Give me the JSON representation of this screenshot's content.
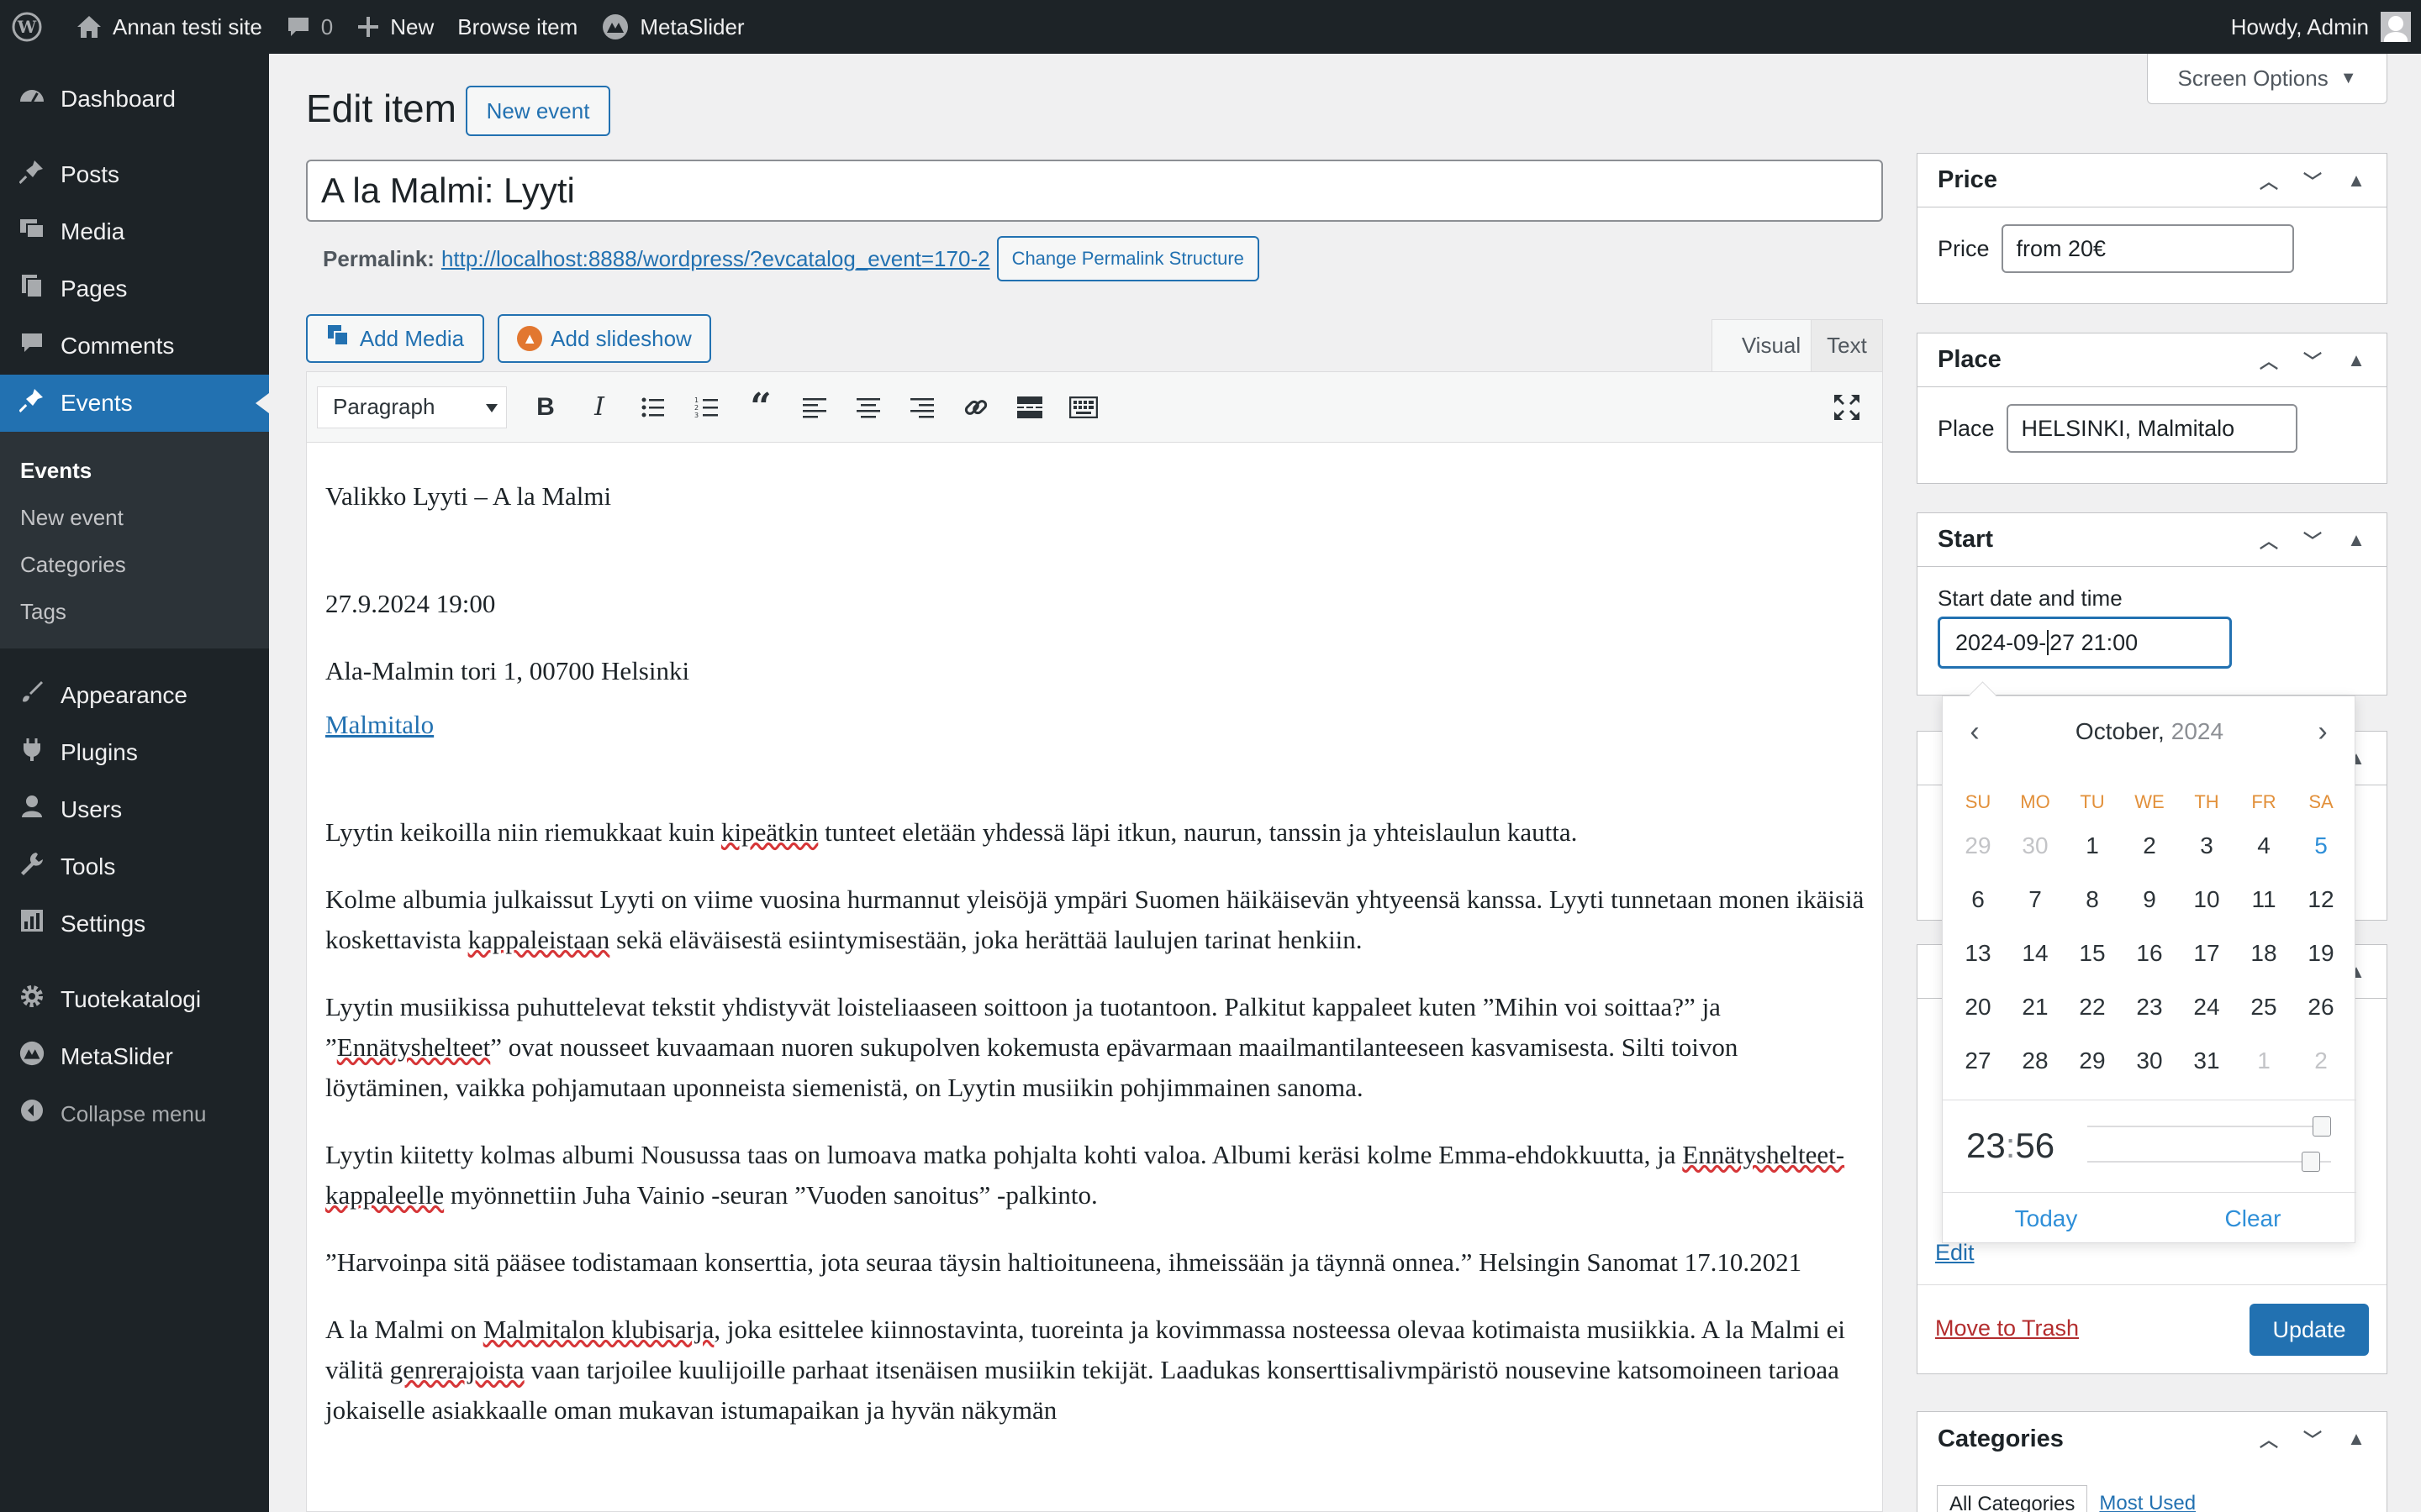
{
  "adminbar": {
    "site_name": "Annan testi site",
    "comments_count": "0",
    "new_label": "New",
    "browse_label": "Browse item",
    "metaslider_label": "MetaSlider",
    "howdy": "Howdy, Admin"
  },
  "sidebar": {
    "items": [
      {
        "label": "Dashboard",
        "icon": "dashboard-icon"
      },
      {
        "label": "Posts",
        "icon": "pin-icon"
      },
      {
        "label": "Media",
        "icon": "media-icon"
      },
      {
        "label": "Pages",
        "icon": "pages-icon"
      },
      {
        "label": "Comments",
        "icon": "comments-icon"
      },
      {
        "label": "Events",
        "icon": "pin-icon"
      },
      {
        "label": "Appearance",
        "icon": "brush-icon"
      },
      {
        "label": "Plugins",
        "icon": "plugin-icon"
      },
      {
        "label": "Users",
        "icon": "users-icon"
      },
      {
        "label": "Tools",
        "icon": "wrench-icon"
      },
      {
        "label": "Settings",
        "icon": "settings-icon"
      },
      {
        "label": "Tuotekatalogi",
        "icon": "gear-icon"
      },
      {
        "label": "MetaSlider",
        "icon": "metaslider-icon"
      }
    ],
    "submenu": [
      "Events",
      "New event",
      "Categories",
      "Tags"
    ],
    "collapse_label": "Collapse menu"
  },
  "header": {
    "screen_options": "Screen Options",
    "page_title": "Edit item",
    "new_event_button": "New event"
  },
  "post": {
    "title": "A la Malmi: Lyyti",
    "permalink_label": "Permalink:",
    "permalink_url": "http://localhost:8888/wordpress/?evcatalog_event=170-2",
    "change_permalink_button": "Change Permalink Structure"
  },
  "editor": {
    "add_media": "Add Media",
    "add_slideshow": "Add slideshow",
    "tab_visual": "Visual",
    "tab_text": "Text",
    "format": "Paragraph",
    "content": {
      "p1": "Valikko Lyyti – A la Malmi",
      "p2": "27.9.2024 19:00",
      "p3": "Ala-Malmin tori 1, 00700 Helsinki",
      "p4_link": "Malmitalo",
      "p5a": "Lyytin keikoilla niin riemukkaat kuin ",
      "p5b": "kipeätkin",
      "p5c": " tunteet eletään yhdessä läpi itkun, naurun, tanssin ja yhteislaulun kautta.",
      "p6a": "Kolme albumia julkaissut Lyyti on viime vuosina hurmannut yleisöjä ympäri Suomen häikäisevän yhtyeensä kanssa. Lyyti tunnetaan monen ikäisiä koskettavista ",
      "p6b": "kappaleistaan",
      "p6c": " sekä eläväisestä esiintymisestään, joka herättää laulujen tarinat henkiin.",
      "p7a": "Lyytin musiikissa puhuttelevat tekstit yhdistyvät loisteliaaseen soittoon ja tuotantoon. Palkitut kappaleet kuten ”Mihin voi soittaa?” ja ”",
      "p7b": "Ennätyshelteet",
      "p7c": "” ovat nousseet kuvaamaan nuoren sukupolven kokemusta epävarmaan maailmantilanteeseen kasvamisesta. Silti toivon löytäminen, vaikka pohjamutaan uponneista siemenistä, on Lyytin musiikin pohjimmainen sanoma.",
      "p8a": "Lyytin kiitetty kolmas albumi Nousussa taas on lumoava matka pohjalta kohti valoa. Albumi keräsi kolme Emma-ehdokkuutta, ja ",
      "p8b": "Ennätyshelteet-kappaleelle",
      "p8c": " myönnettiin Juha Vainio -seuran ”Vuoden sanoitus” -palkinto.",
      "p9": "”Harvoinpa sitä pääsee todistamaan konserttia, jota seuraa täysin haltioituneena, ihmeissään ja täynnä onnea.” Helsingin Sanomat 17.10.2021",
      "p10a": "A la Malmi on ",
      "p10b": "Malmitalon klubisarja",
      "p10c": ", joka esittelee kiinnostavinta, tuoreinta ja kovimmassa nosteessa olevaa kotimaista musiikkia. A la Malmi ei välitä ",
      "p10d": "genrerajoista",
      "p10e": " vaan tarjoilee kuulijoille parhaat itsenäisen musiikin tekijät. Laadukas konserttisalivmpäristö nousevine katsomoineen tarioaa jokaiselle asiakkaalle oman mukavan istumapaikan ja hyvän näkymän"
    }
  },
  "price_box": {
    "title": "Price",
    "label": "Price",
    "value": "from 20€"
  },
  "place_box": {
    "title": "Place",
    "label": "Place",
    "value": "HELSINKI, Malmitalo"
  },
  "start_box": {
    "title": "Start",
    "label": "Start date and time",
    "value_before_cursor": "2024-09-",
    "value_after_cursor": "27 21:00"
  },
  "datepicker": {
    "month": "October,",
    "year": "2024",
    "weekdays": [
      "SU",
      "MO",
      "TU",
      "WE",
      "TH",
      "FR",
      "SA"
    ],
    "days": [
      [
        "29",
        "30",
        "1",
        "2",
        "3",
        "4",
        "5"
      ],
      [
        "6",
        "7",
        "8",
        "9",
        "10",
        "11",
        "12"
      ],
      [
        "13",
        "14",
        "15",
        "16",
        "17",
        "18",
        "19"
      ],
      [
        "20",
        "21",
        "22",
        "23",
        "24",
        "25",
        "26"
      ],
      [
        "27",
        "28",
        "29",
        "30",
        "31",
        "1",
        "2"
      ]
    ],
    "hours": "23",
    "minutes": "56",
    "hour_slider_fraction": 1.0,
    "minute_slider_fraction": 0.95,
    "today": "Today",
    "clear": "Clear"
  },
  "publish": {
    "edit": "Edit",
    "trash": "Move to Trash",
    "update": "Update"
  },
  "categories_box": {
    "title": "Categories",
    "tab_all": "All Categories",
    "tab_most": "Most Used"
  },
  "colors": {
    "accent": "#2271b1",
    "adminbar": "#1d2327",
    "picker_weekday": "#e2903a",
    "picker_blue": "#2f8fd8"
  }
}
